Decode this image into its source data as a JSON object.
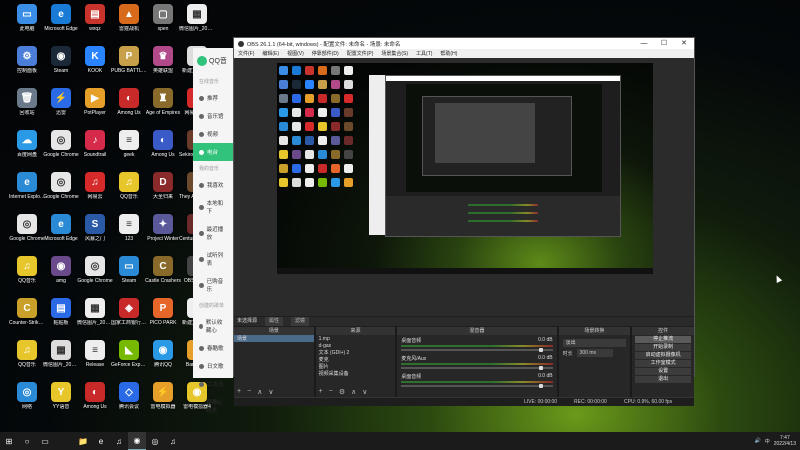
{
  "desktop": {
    "icons": [
      {
        "label": "此电脑",
        "color": "#3a8ee6",
        "glyph": "▭",
        "icon": "computer-icon"
      },
      {
        "label": "Microsoft Edge",
        "color": "#1a7bd6",
        "glyph": "e",
        "icon": "edge-icon"
      },
      {
        "label": "wxqz",
        "color": "#c8342c",
        "glyph": "▤",
        "icon": "app-icon"
      },
      {
        "label": "雷霆战机",
        "color": "#d86a1c",
        "glyph": "▲",
        "icon": "game-icon"
      },
      {
        "label": "spen",
        "color": "#777",
        "glyph": "▢",
        "icon": "file-icon"
      },
      {
        "label": "微信图片_202203...",
        "color": "#eeeeee",
        "glyph": "▦",
        "icon": "qr-image-icon"
      },
      {
        "label": "控制面板",
        "color": "#4a7ed8",
        "glyph": "⚙",
        "icon": "control-panel-icon"
      },
      {
        "label": "Steam",
        "color": "#1b2838",
        "glyph": "◉",
        "icon": "steam-icon"
      },
      {
        "label": "KOOK",
        "color": "#2a84ff",
        "glyph": "K",
        "icon": "kook-icon"
      },
      {
        "label": "PUBG BATTLEGROUNDS",
        "color": "#c8a04a",
        "glyph": "P",
        "icon": "pubg-icon"
      },
      {
        "label": "英雄联盟",
        "color": "#b24a8a",
        "glyph": "♛",
        "icon": "game-icon"
      },
      {
        "label": "新建文本文档",
        "color": "#dddddd",
        "glyph": "≡",
        "icon": "text-file-icon"
      },
      {
        "label": "回收站",
        "color": "#6a7a8a",
        "glyph": "🗑",
        "icon": "recycle-bin-icon"
      },
      {
        "label": "迅雷",
        "color": "#2a6ae6",
        "glyph": "⚡",
        "icon": "xunlei-icon"
      },
      {
        "label": "PotPlayer",
        "color": "#e6a02a",
        "glyph": "▶",
        "icon": "player-icon"
      },
      {
        "label": "Among Us",
        "color": "#c82a2a",
        "glyph": "◐",
        "icon": "among-us-icon"
      },
      {
        "label": "Age of Empires",
        "color": "#8a6a2a",
        "glyph": "♜",
        "icon": "game-icon"
      },
      {
        "label": "网易云音乐",
        "color": "#d62a2a",
        "glyph": "♫",
        "icon": "music-icon"
      },
      {
        "label": "百度网盘",
        "color": "#2a9ae6",
        "glyph": "☁",
        "icon": "cloud-icon"
      },
      {
        "label": "Google Chrome",
        "color": "#e6e6e6",
        "glyph": "◎",
        "icon": "chrome-icon"
      },
      {
        "label": "Soundtrail",
        "color": "#d62a4a",
        "glyph": "♪",
        "icon": "music-icon"
      },
      {
        "label": "geek",
        "color": "#eeeeee",
        "glyph": "≡",
        "icon": "file-icon"
      },
      {
        "label": "Among Us",
        "color": "#3a5ac8",
        "glyph": "◐",
        "icon": "among-us-icon"
      },
      {
        "label": "Sekiro Shadows",
        "color": "#6a3a2a",
        "glyph": "S",
        "icon": "game-icon"
      },
      {
        "label": "Internet Explorer",
        "color": "#2a8ad6",
        "glyph": "e",
        "icon": "ie-icon"
      },
      {
        "label": "Google Chrome",
        "color": "#e6e6e6",
        "glyph": "◎",
        "icon": "chrome-icon"
      },
      {
        "label": "网易云",
        "color": "#d62a2a",
        "glyph": "♫",
        "icon": "music-icon"
      },
      {
        "label": "QQ音乐",
        "color": "#e6c62a",
        "glyph": "♫",
        "icon": "qq-music-icon"
      },
      {
        "label": "大圣归来",
        "color": "#8a2a2a",
        "glyph": "D",
        "icon": "game-icon"
      },
      {
        "label": "They Are Billions",
        "color": "#6a4a2a",
        "glyph": "T",
        "icon": "game-icon"
      },
      {
        "label": "Google Chrome",
        "color": "#e6e6e6",
        "glyph": "◎",
        "icon": "chrome-icon"
      },
      {
        "label": "Microsoft Edge",
        "color": "#2a8ad6",
        "glyph": "e",
        "icon": "edge-icon"
      },
      {
        "label": "风暴之门",
        "color": "#2a5aa6",
        "glyph": "S",
        "icon": "app-icon"
      },
      {
        "label": "123",
        "color": "#eeeeee",
        "glyph": "≡",
        "icon": "file-icon"
      },
      {
        "label": "Project Winter",
        "color": "#5a5a9a",
        "glyph": "✦",
        "icon": "game-icon"
      },
      {
        "label": "Century Age of Ashes",
        "color": "#6a2a2a",
        "glyph": "C",
        "icon": "game-icon"
      },
      {
        "label": "QQ音乐",
        "color": "#e6c62a",
        "glyph": "♫",
        "icon": "qq-music-icon"
      },
      {
        "label": "amg",
        "color": "#6a4a8a",
        "glyph": "◉",
        "icon": "app-icon"
      },
      {
        "label": "Google Chrome",
        "color": "#e6e6e6",
        "glyph": "◎",
        "icon": "chrome-icon"
      },
      {
        "label": "Steam",
        "color": "#2a8ad6",
        "glyph": "▭",
        "icon": "app-icon"
      },
      {
        "label": "Castle Crashers",
        "color": "#8a6a2a",
        "glyph": "C",
        "icon": "game-icon"
      },
      {
        "label": "OBS Studio",
        "color": "#444",
        "glyph": "◉",
        "icon": "obs-icon"
      },
      {
        "label": "Counter-Strike Global Off...",
        "color": "#c8a02a",
        "glyph": "C",
        "icon": "csgo-icon"
      },
      {
        "label": "粘贴板",
        "color": "#2a6ae6",
        "glyph": "▤",
        "icon": "app-icon"
      },
      {
        "label": "微信图片_20081...",
        "color": "#eeeeee",
        "glyph": "▦",
        "icon": "image-icon"
      },
      {
        "label": "国家工商银行 2020",
        "color": "#c82a2a",
        "glyph": "◈",
        "icon": "app-icon"
      },
      {
        "label": "PICO PARK",
        "color": "#e6662a",
        "glyph": "P",
        "icon": "game-icon"
      },
      {
        "label": "新建文本文档",
        "color": "#eeeeee",
        "glyph": "≡",
        "icon": "text-file-icon"
      },
      {
        "label": "QQ音乐",
        "color": "#e6c62a",
        "glyph": "♫",
        "icon": "qq-music-icon"
      },
      {
        "label": "微信图片_20181...",
        "color": "#dddddd",
        "glyph": "▦",
        "icon": "image-icon"
      },
      {
        "label": "Release",
        "color": "#eeeeee",
        "glyph": "≡",
        "icon": "folder-icon"
      },
      {
        "label": "GeForce Experience",
        "color": "#76b900",
        "glyph": "◣",
        "icon": "nvidia-icon"
      },
      {
        "label": "腾讯QQ",
        "color": "#2a9ae6",
        "glyph": "◉",
        "icon": "qq-icon"
      },
      {
        "label": "Bandicam",
        "color": "#e6a02a",
        "glyph": "●",
        "icon": "app-icon"
      },
      {
        "label": "网络",
        "color": "#2a8ad6",
        "glyph": "◎",
        "icon": "network-icon"
      },
      {
        "label": "YY语音",
        "color": "#e6c62a",
        "glyph": "Y",
        "icon": "yy-icon"
      },
      {
        "label": "Among Us",
        "color": "#c82a2a",
        "glyph": "◐",
        "icon": "among-us-icon"
      },
      {
        "label": "腾讯会议",
        "color": "#2a6ae6",
        "glyph": "◇",
        "icon": "app-icon"
      },
      {
        "label": "雷电模拟器",
        "color": "#e6a02a",
        "glyph": "⚡",
        "icon": "app-icon"
      },
      {
        "label": "雷电模拟器4",
        "color": "#e6c62a",
        "glyph": "◉",
        "icon": "app-icon"
      }
    ]
  },
  "qq_music": {
    "logo": "QQ音",
    "section_online": "在线音乐",
    "items_online": [
      {
        "label": "推荐",
        "active": false
      },
      {
        "label": "音乐馆",
        "active": false
      },
      {
        "label": "视频",
        "active": false
      },
      {
        "label": "电台",
        "active": true
      }
    ],
    "section_mine": "我的音乐",
    "items_mine": [
      {
        "label": "我喜欢"
      },
      {
        "label": "本地和下"
      },
      {
        "label": "最近播放"
      },
      {
        "label": "试听列表"
      },
      {
        "label": "已购音乐"
      }
    ],
    "section_created": "创建的歌单",
    "items_created": [
      {
        "label": "默认收藏心"
      },
      {
        "label": "春酷歌"
      },
      {
        "label": "日文歌"
      },
      {
        "label": "二次元"
      },
      {
        "label": "景德心的光"
      }
    ]
  },
  "obs": {
    "title": "OBS 26.1.1 (64-bit, windows) - 配置文件: 未命名 - 场景: 未命名",
    "controls": {
      "minimize": "—",
      "maximize": "☐",
      "close": "✕"
    },
    "menu": [
      "文件(F)",
      "编辑(E)",
      "视图(V)",
      "停靠部件(D)",
      "配置文件(P)",
      "场景集合(S)",
      "工具(T)",
      "帮助(H)"
    ],
    "scene_bar": {
      "label": "未选择源",
      "props": "属性",
      "filters": "滤镜"
    },
    "docks": {
      "scenes": {
        "header": "场景",
        "items": [
          "场景"
        ]
      },
      "sources": {
        "header": "来源",
        "items": [
          "1.mp",
          "d-gas",
          "文本 (GDI+) 2",
          "麦克",
          "图片",
          "视频采集设备"
        ]
      },
      "mixer": {
        "header": "混音器",
        "channels": [
          {
            "name": "桌面音频",
            "db": "0.0 dB"
          },
          {
            "name": "麦克风/Aux",
            "db": "0.0 dB"
          },
          {
            "name": "桌面音频",
            "db": "0.0 dB"
          }
        ]
      },
      "transitions": {
        "header": "场景转换",
        "selected": "淡出",
        "duration_label": "时长",
        "duration": "300 ms"
      },
      "controls": {
        "header": "控件",
        "buttons": [
          "停止推流",
          "开始录制",
          "启动虚拟摄像机",
          "工作室模式",
          "设置",
          "退出"
        ]
      }
    },
    "status": {
      "live": "LIVE: 00:00:00",
      "rec": "REC: 00:00:00",
      "cpu": "CPU: 0.9%, 60.00 fps"
    }
  },
  "taskbar": {
    "start": "⊞",
    "search": "○",
    "taskview": "▭",
    "apps": [
      "📁",
      "e",
      "♫",
      "◉",
      "◎",
      "♫"
    ],
    "tray": {
      "time": "7:47",
      "date": "2022/4/13",
      "lang": "中",
      "volume": "🔊"
    }
  }
}
